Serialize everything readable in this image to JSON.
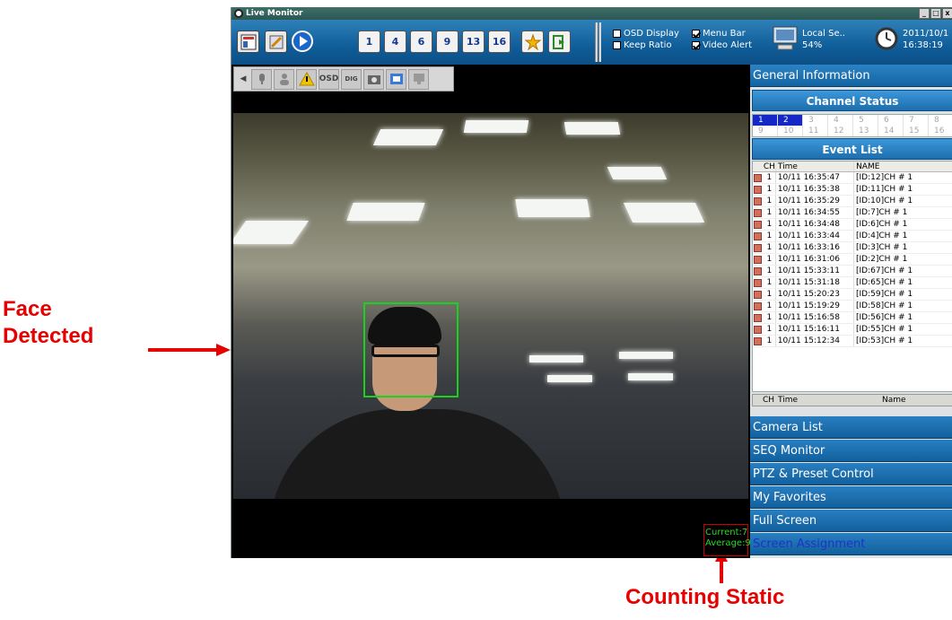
{
  "window": {
    "title": "Live Monitor",
    "min_label": "_",
    "max_label": "□",
    "close_label": "x"
  },
  "toolbar": {
    "split_buttons": [
      "1",
      "4",
      "6",
      "9",
      "13",
      "16"
    ],
    "osd_display": "OSD Display",
    "keep_ratio": "Keep Ratio",
    "menu_bar": "Menu Bar",
    "video_alert": "Video Alert",
    "local_server": "Local Se..",
    "cpu_usage": "54%",
    "date": "2011/10/1",
    "time": "16:38:19"
  },
  "video_toolbar": {
    "osd_label": "OSD",
    "dig_label": "DIG"
  },
  "video": {
    "count_current": "Current:7",
    "count_average": "Average:9"
  },
  "panel": {
    "general_information": "General Information",
    "channel_status": "Channel Status",
    "channels": [
      "1",
      "2",
      "3",
      "4",
      "5",
      "6",
      "7",
      "8",
      "9",
      "10",
      "11",
      "12",
      "13",
      "14",
      "15",
      "16"
    ],
    "active_channels": [
      "1",
      "2"
    ],
    "event_list": "Event List",
    "event_columns": {
      "ch": "CH",
      "time": "Time",
      "name": "NAME"
    },
    "events": [
      {
        "ch": "1",
        "time": "10/11 16:35:47",
        "name": "[ID:12]CH # 1"
      },
      {
        "ch": "1",
        "time": "10/11 16:35:38",
        "name": "[ID:11]CH # 1"
      },
      {
        "ch": "1",
        "time": "10/11 16:35:29",
        "name": "[ID:10]CH # 1"
      },
      {
        "ch": "1",
        "time": "10/11 16:34:55",
        "name": "[ID:7]CH # 1"
      },
      {
        "ch": "1",
        "time": "10/11 16:34:48",
        "name": "[ID:6]CH # 1"
      },
      {
        "ch": "1",
        "time": "10/11 16:33:44",
        "name": "[ID:4]CH # 1"
      },
      {
        "ch": "1",
        "time": "10/11 16:33:16",
        "name": "[ID:3]CH # 1"
      },
      {
        "ch": "1",
        "time": "10/11 16:31:06",
        "name": "[ID:2]CH # 1"
      },
      {
        "ch": "1",
        "time": "10/11 15:33:11",
        "name": "[ID:67]CH # 1"
      },
      {
        "ch": "1",
        "time": "10/11 15:31:18",
        "name": "[ID:65]CH # 1"
      },
      {
        "ch": "1",
        "time": "10/11 15:20:23",
        "name": "[ID:59]CH # 1"
      },
      {
        "ch": "1",
        "time": "10/11 15:19:29",
        "name": "[ID:58]CH # 1"
      },
      {
        "ch": "1",
        "time": "10/11 15:16:58",
        "name": "[ID:56]CH # 1"
      },
      {
        "ch": "1",
        "time": "10/11 15:16:11",
        "name": "[ID:55]CH # 1"
      },
      {
        "ch": "1",
        "time": "10/11 15:12:34",
        "name": "[ID:53]CH # 1"
      }
    ],
    "footer_columns": {
      "ch": "CH",
      "time": "Time",
      "name": "Name"
    },
    "menu": {
      "camera_list": "Camera List",
      "seq_monitor": "SEQ Monitor",
      "ptz_preset": "PTZ & Preset Control",
      "my_favorites": "My Favorites",
      "full_screen": "Full Screen",
      "screen_assignment": "Screen Assignment"
    }
  },
  "annotations": {
    "face_detected_line1": "Face",
    "face_detected_line2": "Detected",
    "counting_static": "Counting Static"
  },
  "colors": {
    "annotation": "#e60000",
    "face_box": "#17d41b",
    "panel_blue": "#1363a1",
    "screen_assignment_text": "#1e33c8"
  }
}
